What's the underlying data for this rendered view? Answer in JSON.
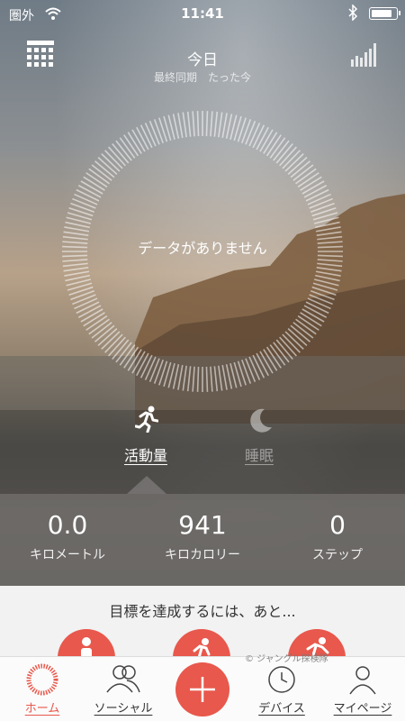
{
  "status": {
    "carrier": "圏外",
    "time": "11:41",
    "battery_level": 0.9
  },
  "header": {
    "title": "今日",
    "subtitle": "最終同期　たった今"
  },
  "main": {
    "ring_message": "データがありません"
  },
  "tabs": [
    {
      "label": "活動量",
      "icon": "running-icon",
      "active": true
    },
    {
      "label": "睡眠",
      "icon": "moon-icon",
      "active": false
    }
  ],
  "metrics": [
    {
      "value": "0.0",
      "unit": "キロメートル"
    },
    {
      "value": "941",
      "unit": "キロカロリー"
    },
    {
      "value": "0",
      "unit": "ステップ"
    }
  ],
  "goal": {
    "text": "目標を達成するには、あと..."
  },
  "tabbar": [
    {
      "label": "ホーム",
      "icon": "home-ring-icon",
      "active": true
    },
    {
      "label": "ソーシャル",
      "icon": "people-icon",
      "active": false
    },
    {
      "label": "",
      "icon": "plus-icon",
      "active": false
    },
    {
      "label": "デバイス",
      "icon": "device-icon",
      "active": false
    },
    {
      "label": "マイページ",
      "icon": "person-icon",
      "active": false
    }
  ],
  "watermark": "© ジャングル探検隊",
  "colors": {
    "accent": "#e8584c"
  }
}
